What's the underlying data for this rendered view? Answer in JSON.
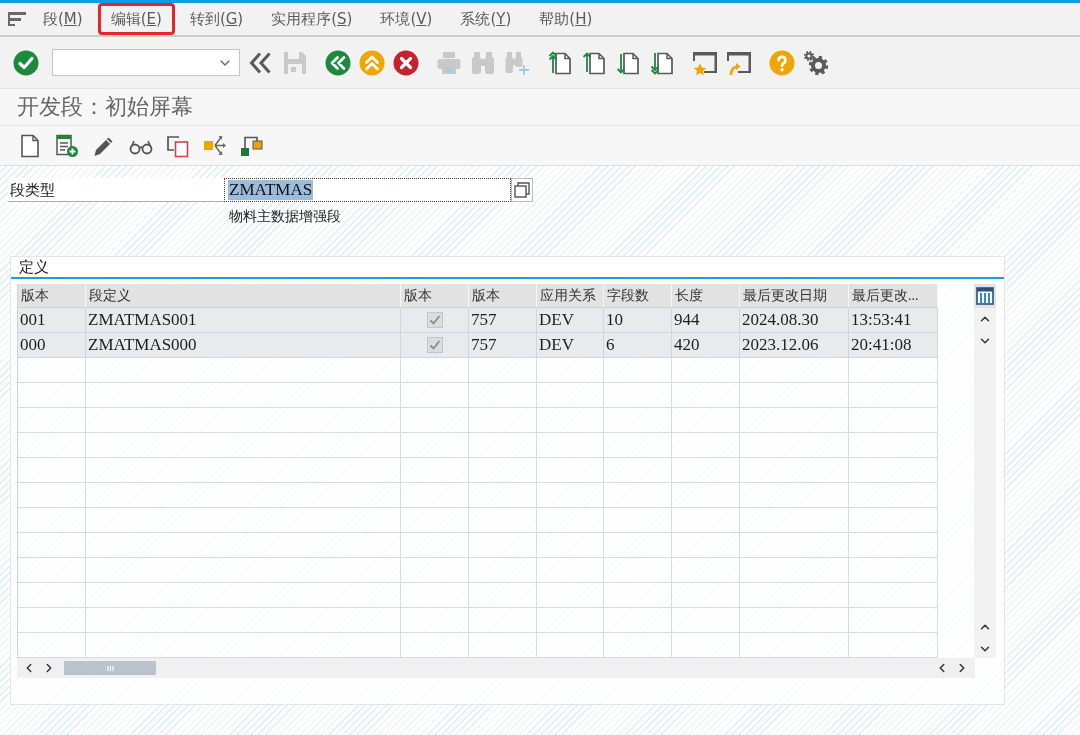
{
  "menu_bar": {
    "items": [
      {
        "before": "段(",
        "mnemonic": "M",
        "after": ")",
        "highlighted": false
      },
      {
        "before": "编辑(",
        "mnemonic": "E",
        "after": ")",
        "highlighted": true
      },
      {
        "before": "转到(",
        "mnemonic": "G",
        "after": ")",
        "highlighted": false
      },
      {
        "before": "实用程序(",
        "mnemonic": "S",
        "after": ")",
        "highlighted": false
      },
      {
        "before": "环境(",
        "mnemonic": "V",
        "after": ")",
        "highlighted": false
      },
      {
        "before": "系统(",
        "mnemonic": "Y",
        "after": ")",
        "highlighted": false
      },
      {
        "before": "帮助(",
        "mnemonic": "H",
        "after": ")",
        "highlighted": false
      }
    ]
  },
  "toolbar": {
    "groups": [
      {
        "buttons": [
          {
            "kind": "enter",
            "disabled": false
          },
          {
            "kind": "command_field",
            "disabled": false
          },
          {
            "kind": "collapse",
            "disabled": false
          },
          {
            "kind": "save",
            "disabled": true
          }
        ]
      },
      {
        "buttons": [
          {
            "kind": "back",
            "disabled": false
          },
          {
            "kind": "exit",
            "disabled": false
          },
          {
            "kind": "cancel",
            "disabled": false
          }
        ]
      },
      {
        "buttons": [
          {
            "kind": "print",
            "disabled": true
          },
          {
            "kind": "find",
            "disabled": true
          },
          {
            "kind": "find_next",
            "disabled": true
          }
        ]
      },
      {
        "buttons": [
          {
            "kind": "first_page",
            "disabled": false
          },
          {
            "kind": "previous_page",
            "disabled": false
          },
          {
            "kind": "next_page",
            "disabled": false
          },
          {
            "kind": "last_page",
            "disabled": false
          }
        ]
      },
      {
        "buttons": [
          {
            "kind": "new_session",
            "disabled": false
          },
          {
            "kind": "shortcut",
            "disabled": false
          }
        ]
      },
      {
        "buttons": [
          {
            "kind": "help",
            "disabled": false
          },
          {
            "kind": "settings",
            "disabled": false
          }
        ]
      }
    ]
  },
  "title": "开发段：初始屏幕",
  "segment_type": {
    "label": "段类型",
    "value": "ZMATMAS",
    "value_selected": true,
    "description": "物料主数据增强段"
  },
  "definition": {
    "title": "定义",
    "table": {
      "columns": [
        "版本",
        "段定义",
        "版本",
        "版本",
        "应用关系",
        "字段数",
        "长度",
        "最后更改日期",
        "最后更改..."
      ],
      "rows": [
        {
          "cells": [
            {
              "kind": "text",
              "text": "001"
            },
            {
              "kind": "text",
              "text": "ZMATMAS001"
            },
            {
              "kind": "checkbox",
              "checked": true,
              "disabled": true
            },
            {
              "kind": "text",
              "text": "757"
            },
            {
              "kind": "text",
              "text": "DEV"
            },
            {
              "kind": "text",
              "text": "10"
            },
            {
              "kind": "text",
              "text": "944"
            },
            {
              "kind": "text",
              "text": "2024.08.30"
            },
            {
              "kind": "text",
              "text": "13:53:41"
            }
          ]
        },
        {
          "cells": [
            {
              "kind": "text",
              "text": "000"
            },
            {
              "kind": "text",
              "text": "ZMATMAS000"
            },
            {
              "kind": "checkbox",
              "checked": true,
              "disabled": true
            },
            {
              "kind": "text",
              "text": "757"
            },
            {
              "kind": "text",
              "text": "DEV"
            },
            {
              "kind": "text",
              "text": "6"
            },
            {
              "kind": "text",
              "text": "420"
            },
            {
              "kind": "text",
              "text": "2023.12.06"
            },
            {
              "kind": "text",
              "text": "20:41:08"
            }
          ]
        }
      ]
    }
  }
}
